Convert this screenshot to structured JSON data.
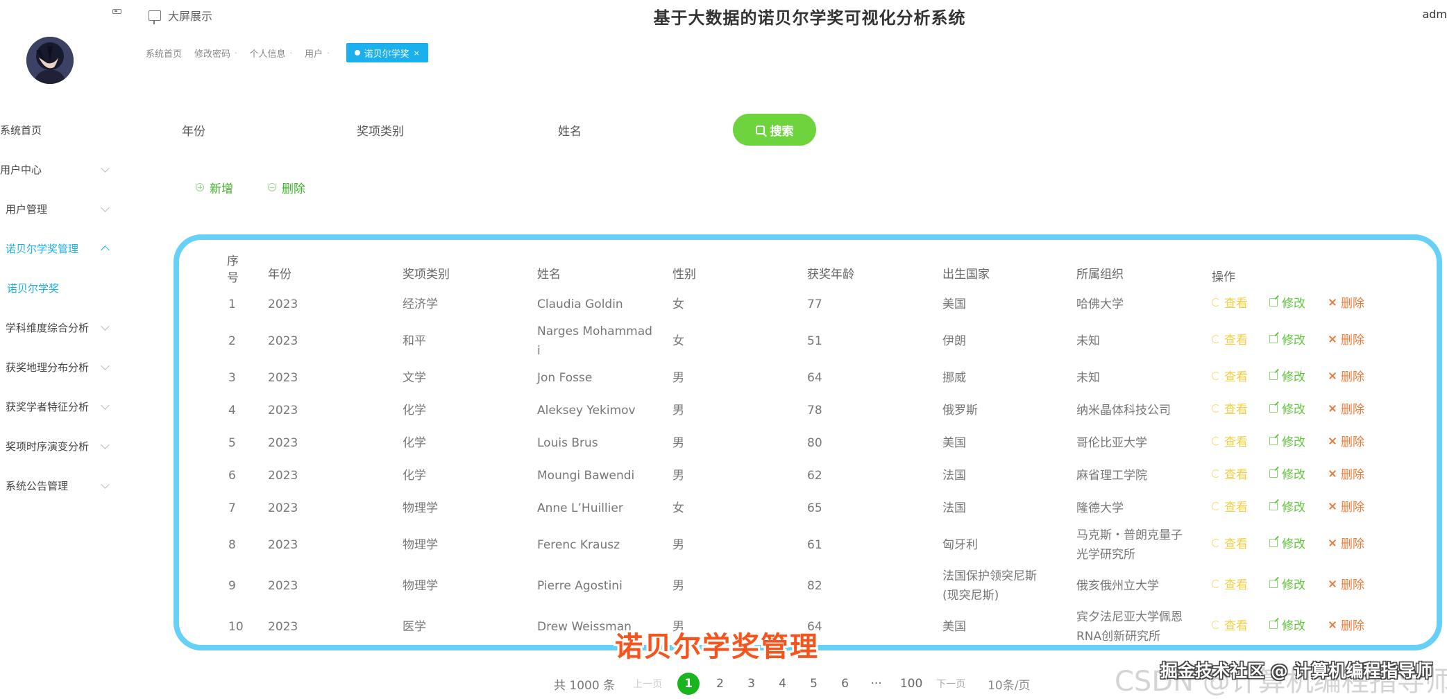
{
  "header": {
    "screen_link": "大屏展示",
    "title": "基于大数据的诺贝尔学奖可视化分析系统",
    "user": "adm"
  },
  "tabs": [
    {
      "label": "系统首页",
      "active": false
    },
    {
      "label": "修改密码",
      "active": false
    },
    {
      "label": "个人信息",
      "active": false
    },
    {
      "label": "用户",
      "active": false
    },
    {
      "label": "诺贝尔学奖",
      "active": true
    }
  ],
  "sidebar": {
    "items": [
      {
        "label": "系统首页"
      },
      {
        "label": "用户中心"
      },
      {
        "label": "用户管理"
      },
      {
        "label": "诺贝尔学奖管理"
      },
      {
        "label": "诺贝尔学奖"
      },
      {
        "label": "学科维度综合分析"
      },
      {
        "label": "获奖地理分布分析"
      },
      {
        "label": "获奖学者特征分析"
      },
      {
        "label": "奖项时序演变分析"
      },
      {
        "label": "系统公告管理"
      }
    ]
  },
  "search": {
    "year_label": "年份",
    "category_label": "奖项类别",
    "name_label": "姓名",
    "button": "搜索"
  },
  "actions": {
    "add": "新增",
    "delete": "删除"
  },
  "table": {
    "headers": [
      "序号",
      "年份",
      "奖项类别",
      "姓名",
      "性别",
      "获奖年龄",
      "出生国家",
      "所属组织",
      "操作"
    ],
    "op_labels": {
      "view": "查看",
      "edit": "修改",
      "delete": "删除"
    },
    "rows": [
      {
        "idx": "1",
        "year": "2023",
        "category": "经济学",
        "name": "Claudia Goldin",
        "gender": "女",
        "age": "77",
        "country": "美国",
        "org": "哈佛大学"
      },
      {
        "idx": "2",
        "year": "2023",
        "category": "和平",
        "name": "Narges Mohammad\ni",
        "gender": "女",
        "age": "51",
        "country": "伊朗",
        "org": "未知"
      },
      {
        "idx": "3",
        "year": "2023",
        "category": "文学",
        "name": "Jon Fosse",
        "gender": "男",
        "age": "64",
        "country": "挪威",
        "org": "未知"
      },
      {
        "idx": "4",
        "year": "2023",
        "category": "化学",
        "name": "Aleksey Yekimov",
        "gender": "男",
        "age": "78",
        "country": "俄罗斯",
        "org": "纳米晶体科技公司"
      },
      {
        "idx": "5",
        "year": "2023",
        "category": "化学",
        "name": "Louis Brus",
        "gender": "男",
        "age": "80",
        "country": "美国",
        "org": "哥伦比亚大学"
      },
      {
        "idx": "6",
        "year": "2023",
        "category": "化学",
        "name": "Moungi Bawendi",
        "gender": "男",
        "age": "62",
        "country": "法国",
        "org": "麻省理工学院"
      },
      {
        "idx": "7",
        "year": "2023",
        "category": "物理学",
        "name": "Anne L’Huillier",
        "gender": "女",
        "age": "65",
        "country": "法国",
        "org": "隆德大学"
      },
      {
        "idx": "8",
        "year": "2023",
        "category": "物理学",
        "name": "Ferenc Krausz",
        "gender": "男",
        "age": "61",
        "country": "匈牙利",
        "org": "马克斯・普朗克量子\n光学研究所"
      },
      {
        "idx": "9",
        "year": "2023",
        "category": "物理学",
        "name": "Pierre Agostini",
        "gender": "男",
        "age": "82",
        "country": "法国保护领突尼斯\n(现突尼斯)",
        "org": "俄亥俄州立大学"
      },
      {
        "idx": "10",
        "year": "2023",
        "category": "医学",
        "name": "Drew Weissman",
        "gender": "男",
        "age": "64",
        "country": "美国",
        "org": "宾夕法尼亚大学佩恩\nRNA创新研究所"
      }
    ]
  },
  "caption": "诺贝尔学奖管理",
  "pagination": {
    "total": "共 1000 条",
    "prev": "上一页",
    "pages": [
      "1",
      "2",
      "3",
      "4",
      "5",
      "6",
      "···",
      "100"
    ],
    "active_page": "1",
    "next": "下一页",
    "page_size": "10条/页"
  },
  "watermark": {
    "juejin": "掘金技术社区 @ 计算机编程指导师",
    "csdn": "CSDN @计算机编程指导师"
  }
}
